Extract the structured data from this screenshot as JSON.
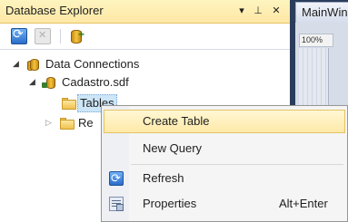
{
  "explorer": {
    "title": "Database Explorer",
    "title_buttons": {
      "dropdown": "▾",
      "pin": "⊥",
      "close": "✕"
    },
    "toolbar": [
      "refresh-icon",
      "stop-icon",
      "connect-to-database-icon"
    ],
    "tree": {
      "root": {
        "label": "Data Connections",
        "expanded": true
      },
      "database": {
        "label": "Cadastro.sdf",
        "expanded": true
      },
      "tables": {
        "label": "Tables",
        "selected": true
      },
      "views": {
        "label": "Re",
        "expanded": false
      }
    }
  },
  "document": {
    "tab_label": "MainWin",
    "zoom": "100%"
  },
  "context_menu": {
    "items": [
      {
        "label": "Create Table",
        "highlighted": true
      },
      {
        "label": "New Query"
      },
      {
        "label": "Refresh",
        "icon": "refresh-icon"
      },
      {
        "label": "Properties",
        "icon": "properties-icon",
        "shortcut": "Alt+Enter"
      }
    ]
  },
  "colors": {
    "title_bar": "#ffe8a6",
    "selection": "#cde6f7",
    "menu_highlight": "#ffe9a8",
    "ide_background": "#2b3d5c"
  }
}
